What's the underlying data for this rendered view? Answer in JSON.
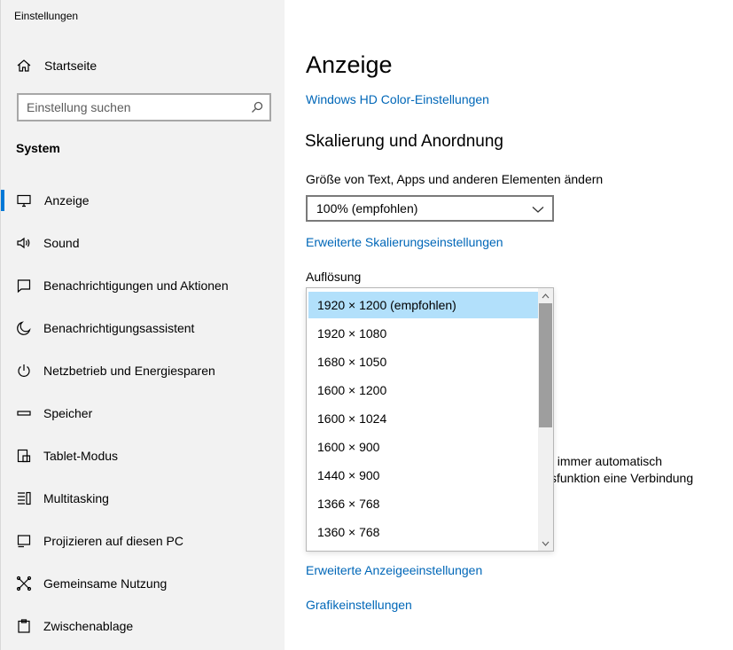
{
  "window": {
    "title": "Einstellungen"
  },
  "sidebar": {
    "home_label": "Startseite",
    "search_placeholder": "Einstellung suchen",
    "section": "System",
    "items": [
      {
        "label": "Anzeige",
        "icon": "monitor-icon",
        "active": true
      },
      {
        "label": "Sound",
        "icon": "speaker-icon"
      },
      {
        "label": "Benachrichtigungen und Aktionen",
        "icon": "notification-icon"
      },
      {
        "label": "Benachrichtigungsassistent",
        "icon": "moon-icon"
      },
      {
        "label": "Netzbetrieb und Energiesparen",
        "icon": "power-icon"
      },
      {
        "label": "Speicher",
        "icon": "storage-icon"
      },
      {
        "label": "Tablet-Modus",
        "icon": "tablet-icon"
      },
      {
        "label": "Multitasking",
        "icon": "multitasking-icon"
      },
      {
        "label": "Projizieren auf diesen PC",
        "icon": "projector-icon"
      },
      {
        "label": "Gemeinsame Nutzung",
        "icon": "share-icon"
      },
      {
        "label": "Zwischenablage",
        "icon": "clipboard-icon"
      }
    ]
  },
  "main": {
    "title": "Anzeige",
    "hd_color_link": "Windows HD Color-Einstellungen",
    "scaling_heading": "Skalierung und Anordnung",
    "scale_label": "Größe von Text, Apps und anderen Elementen ändern",
    "scale_value": "100% (empfohlen)",
    "advanced_scaling_link": "Erweiterte Skalierungseinstellungen",
    "resolution_label": "Auflösung",
    "resolution_options": [
      "1920 × 1200 (empfohlen)",
      "1920 × 1080",
      "1680 × 1050",
      "1600 × 1200",
      "1600 × 1024",
      "1600 × 900",
      "1440 × 900",
      "1366 × 768",
      "1360 × 768"
    ],
    "selected_resolution_index": 0,
    "partial_text_1": "t immer automatisch",
    "partial_text_2": "sfunktion eine Verbindung",
    "advanced_display_link": "Erweiterte Anzeigeeinstellungen",
    "graphics_link": "Grafikeinstellungen"
  },
  "colors": {
    "accent": "#0078d7",
    "link": "#0067b8",
    "selected_option": "#b2e0fb",
    "sidebar_bg": "#f2f2f2"
  }
}
